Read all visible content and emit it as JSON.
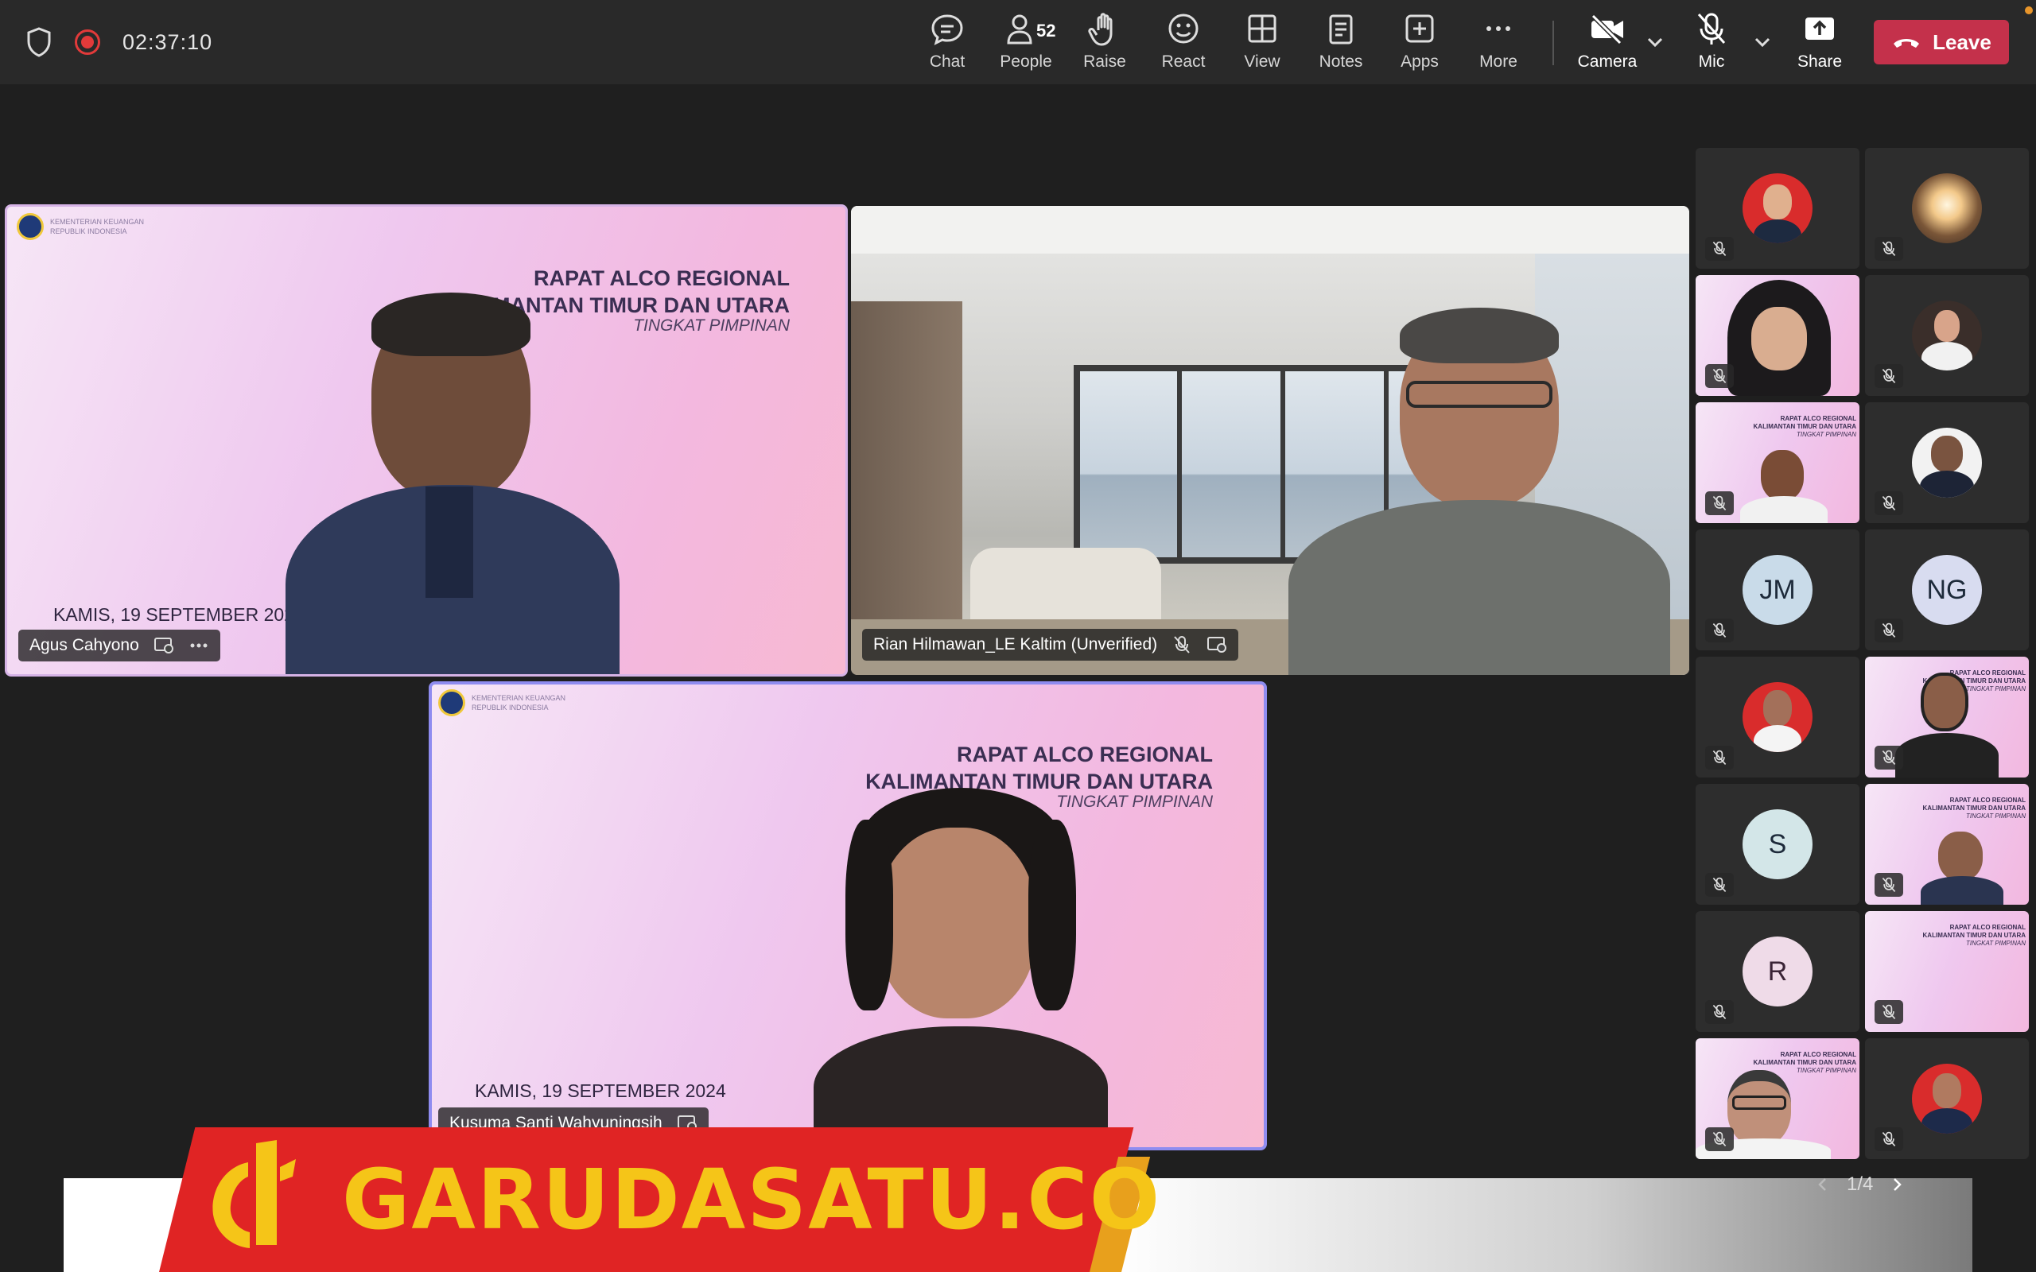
{
  "topbar": {
    "timer": "02:37:10",
    "buttons": {
      "chat": "Chat",
      "people": "People",
      "people_count": "52",
      "raise": "Raise",
      "react": "React",
      "view": "View",
      "notes": "Notes",
      "apps": "Apps",
      "more": "More",
      "camera": "Camera",
      "mic": "Mic",
      "share": "Share",
      "leave": "Leave"
    },
    "leave_color": "#c4314b"
  },
  "main_tiles": {
    "tile1": {
      "name": "Agus Cahyono",
      "slide_title_1": "RAPAT ALCO REGIONAL",
      "slide_title_2": "KALIMANTAN TIMUR DAN UTARA",
      "slide_sub": "TINGKAT PIMPINAN",
      "slide_date": "KAMIS, 19 SEPTEMBER 2024"
    },
    "tile2": {
      "name": "Rian Hilmawan_LE Kaltim (Unverified)"
    },
    "tile3": {
      "name": "Kusuma Santi Wahyuningsih",
      "slide_title_1": "RAPAT ALCO REGIONAL",
      "slide_title_2": "KALIMANTAN TIMUR DAN UTARA",
      "slide_sub": "TINGKAT PIMPINAN",
      "slide_date": "KAMIS, 19 SEPTEMBER 2024"
    }
  },
  "gallery": {
    "initials": {
      "jm": "JM",
      "ng": "NG",
      "s": "S",
      "r": "R"
    },
    "mini_title_1": "RAPAT ALCO REGIONAL",
    "mini_title_2": "KALIMANTAN TIMUR DAN UTARA",
    "mini_sub": "TINGKAT PIMPINAN"
  },
  "pager": {
    "label": "1/4"
  },
  "watermark": {
    "brand": "GARUDASATU.CO"
  }
}
